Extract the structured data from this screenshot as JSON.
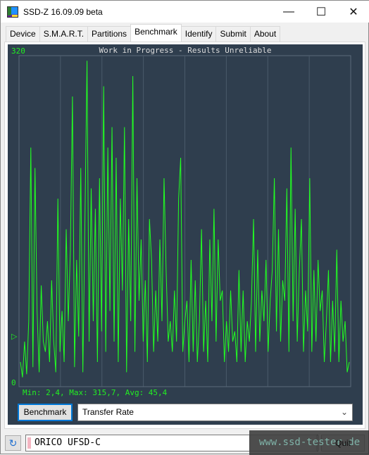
{
  "window": {
    "title": "SSD-Z 16.09.09 beta"
  },
  "tabs": [
    {
      "label": "Device"
    },
    {
      "label": "S.M.A.R.T."
    },
    {
      "label": "Partitions"
    },
    {
      "label": "Benchmark",
      "active": true
    },
    {
      "label": "Identify"
    },
    {
      "label": "Submit"
    },
    {
      "label": "About"
    }
  ],
  "benchmark": {
    "button_label": "Benchmark",
    "mode_value": "Transfer Rate"
  },
  "status": {
    "device": "ORICO UFSD-C",
    "right_button": "Quit"
  },
  "watermark": "www.ssd-tester.de",
  "colors": {
    "plot_bg": "#2f3e4e",
    "line": "#22ff22",
    "grid": "#4a5a6a"
  },
  "chart_data": {
    "type": "line",
    "title": "Work in Progress - Results Unreliable",
    "ylim": [
      0,
      320
    ],
    "ytick_top": "320",
    "ytick_bottom": "0",
    "grid": true,
    "stats_text": "Min: 2,4, Max: 315,7, Avg: 45,4",
    "min": 2.4,
    "max": 315.7,
    "avg": 45.4,
    "values": [
      20,
      5,
      40,
      8,
      60,
      230,
      15,
      210,
      70,
      10,
      95,
      40,
      30,
      60,
      20,
      100,
      40,
      10,
      180,
      30,
      70,
      20,
      150,
      60,
      130,
      280,
      15,
      120,
      45,
      210,
      10,
      160,
      315,
      40,
      190,
      60,
      170,
      20,
      200,
      50,
      290,
      30,
      230,
      70,
      250,
      40,
      220,
      20,
      180,
      90,
      250,
      10,
      160,
      60,
      300,
      30,
      200,
      80,
      140,
      40,
      100,
      20,
      160,
      120,
      30,
      90,
      40,
      140,
      60,
      200,
      110,
      40,
      60,
      30,
      90,
      40,
      180,
      220,
      30,
      60,
      80,
      20,
      120,
      30,
      100,
      20,
      60,
      150,
      30,
      80,
      20,
      140,
      60,
      170,
      40,
      140,
      80,
      90,
      20,
      60,
      30,
      90,
      40,
      50,
      20,
      110,
      30,
      90,
      20,
      60,
      40,
      80,
      160,
      30,
      130,
      40,
      90,
      60,
      120,
      30,
      80,
      110,
      200,
      50,
      150,
      40,
      100,
      80,
      190,
      30,
      230,
      60,
      170,
      40,
      110,
      160,
      30,
      90,
      50,
      200,
      30,
      110,
      40,
      120,
      70,
      90,
      20,
      60,
      110,
      20,
      80,
      30,
      130,
      20,
      80,
      40,
      60,
      10,
      20
    ]
  }
}
